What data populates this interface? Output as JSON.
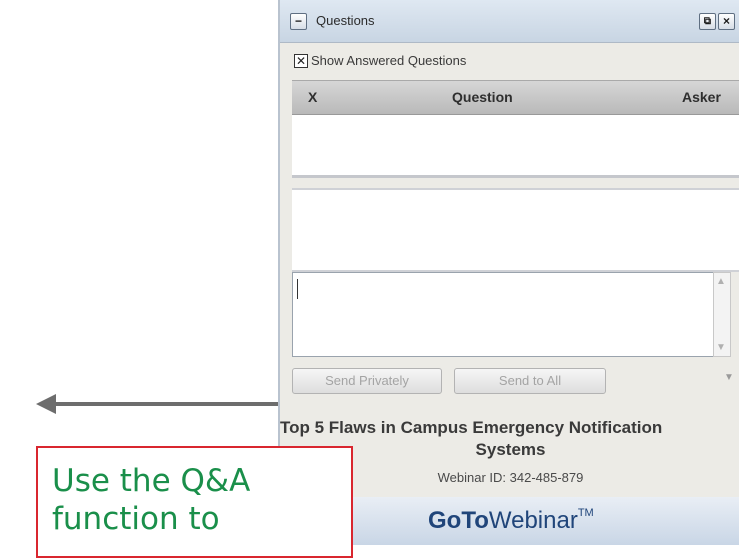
{
  "window": {
    "title": "Questions",
    "collapse_icon": "minus",
    "popout_icon": "popout-icon",
    "close_icon": "close-icon"
  },
  "show_answered": {
    "label": "Show Answered Questions",
    "checked": true
  },
  "table": {
    "columns": [
      "X",
      "Question",
      "Asker"
    ],
    "rows": []
  },
  "input": {
    "value": ""
  },
  "buttons": {
    "send_privately": "Send Privately",
    "send_to_all": "Send to All"
  },
  "webinar": {
    "title_line1": "Top 5 Flaws in Campus Emergency Notification",
    "title_line2": "Systems",
    "id_text": "Webinar ID: 342-485-879",
    "brand_bold": "GoTo",
    "brand_regular": "Webinar",
    "brand_tm": "TM"
  },
  "callout": {
    "text": "Use the Q&A function to"
  },
  "colors": {
    "callout_border": "#d9262f",
    "callout_text": "#1a8f4a",
    "brand": "#20457a"
  }
}
